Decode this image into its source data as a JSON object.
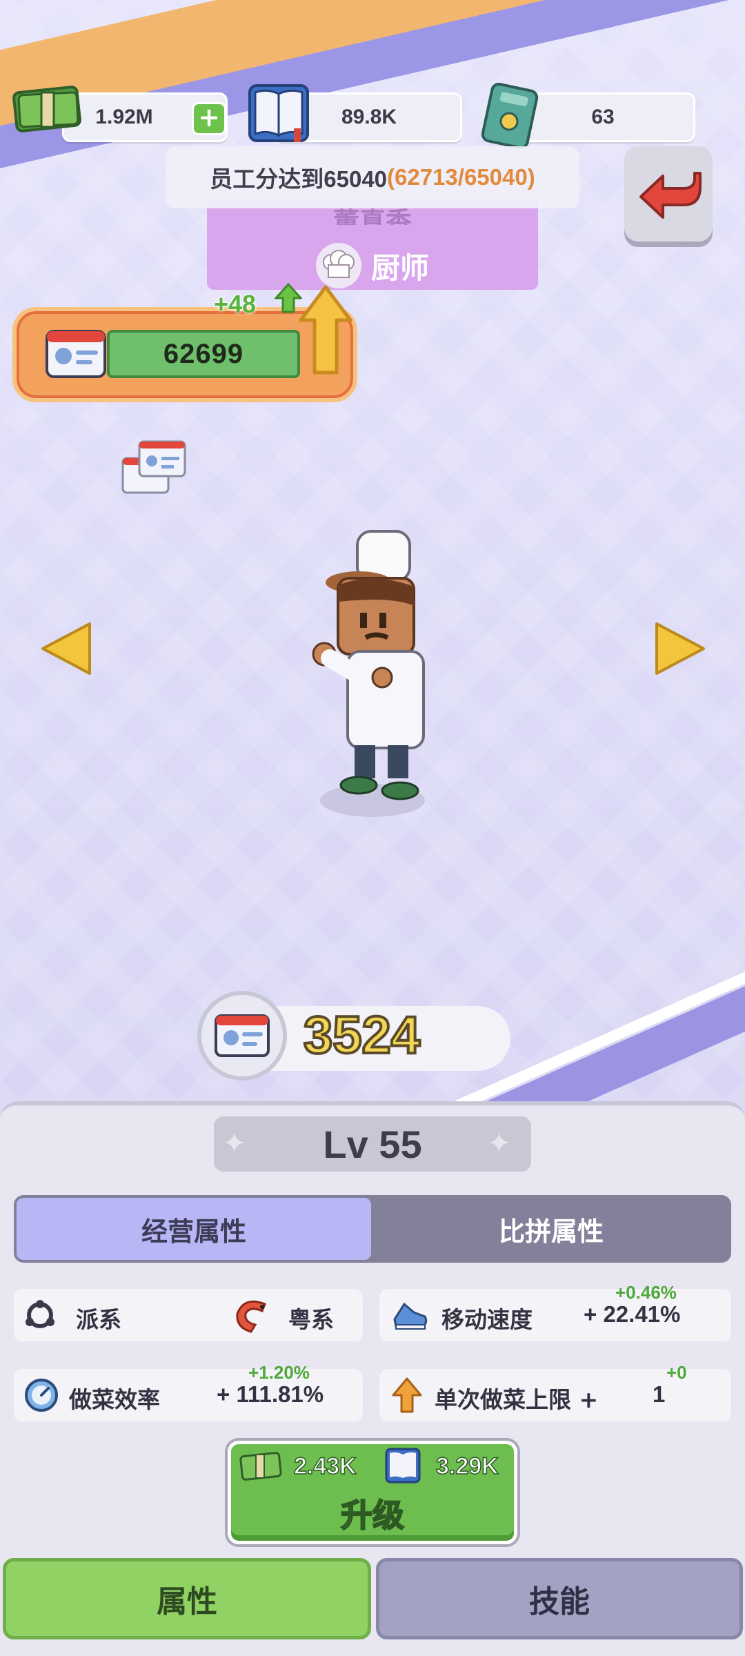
{
  "currencies": {
    "cash": "1.92M",
    "books": "89.8K",
    "cards": "63"
  },
  "goal": {
    "text": "员工分达到65040",
    "progress": "(62713/65040)"
  },
  "character": {
    "name": "董真香",
    "role": "厨师"
  },
  "staff_score": {
    "value": "62699",
    "delta": "+48"
  },
  "badge_value": "3524",
  "level": "Lv 55",
  "attr_tabs": {
    "active": "经营属性",
    "inactive": "比拼属性"
  },
  "attributes": {
    "faction_label": "派系",
    "faction_value": "粤系",
    "move_speed_label": "移动速度",
    "move_speed_value": "+  22.41%",
    "move_speed_delta": "+0.46%",
    "cook_eff_label": "做菜效率",
    "cook_eff_value": "+ 111.81%",
    "cook_eff_delta": "+1.20%",
    "cook_limit_label": "单次做菜上限 +",
    "cook_limit_value": "1",
    "cook_limit_delta": "+0"
  },
  "upgrade": {
    "cash_cost": "2.43K",
    "book_cost": "3.29K",
    "label": "升级"
  },
  "bottom_tabs": {
    "attributes": "属性",
    "skills": "技能"
  },
  "colors": {
    "accent_green": "#6dbd4f",
    "tab_active": "#b8b6f5",
    "goal_progress": "#e28a3c",
    "delta_green": "#4ea83a"
  }
}
